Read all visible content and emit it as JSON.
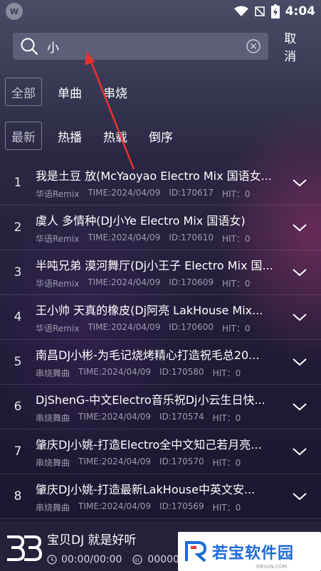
{
  "status_bar": {
    "time": "4:04",
    "icons": [
      "wifi-icon",
      "sim-off-icon",
      "battery-charging-icon"
    ]
  },
  "search": {
    "query": "小",
    "cancel_label": "取消"
  },
  "filters": {
    "type_row": [
      {
        "label": "全部",
        "active": true
      },
      {
        "label": "单曲",
        "active": false
      },
      {
        "label": "串烧",
        "active": false
      }
    ],
    "sort_row": [
      {
        "label": "最新",
        "active": true
      },
      {
        "label": "热播",
        "active": false
      },
      {
        "label": "热载",
        "active": false
      },
      {
        "label": "倒序",
        "active": false
      }
    ]
  },
  "songs": [
    {
      "num": "1",
      "title": "我是土豆 放(McYaoyao Electro Mix 国语女...",
      "genre": "华语Remix",
      "time": "TIME:2024/04/09",
      "id": "ID:170617",
      "hit": "HIT：0"
    },
    {
      "num": "2",
      "title": "虞人 多情种(DJ小Ye Electro Mix 国语女)",
      "genre": "华语Remix",
      "time": "TIME:2024/04/09",
      "id": "ID:170610",
      "hit": "HIT：0"
    },
    {
      "num": "3",
      "title": "半吨兄弟 漠河舞厅(Dj小王子 Electro Mix 国...",
      "genre": "华语Remix",
      "time": "TIME:2024/04/09",
      "id": "ID:170609",
      "hit": "HIT：0"
    },
    {
      "num": "4",
      "title": "王小帅 天真的橡皮(Dj阿亮 LakHouse Mix...",
      "genre": "华语Remix",
      "time": "TIME:2024/04/09",
      "id": "ID:170600",
      "hit": "HIT：0"
    },
    {
      "num": "5",
      "title": "南昌DJ小彬-为毛记烧烤精心打造祝毛总20...",
      "genre": "串烧舞曲",
      "time": "TIME:2024/04/09",
      "id": "ID:170580",
      "hit": "HIT：0"
    },
    {
      "num": "6",
      "title": "DjShenG-中文Electro音乐祝Dj小云生日快...",
      "genre": "串烧舞曲",
      "time": "TIME:2024/04/09",
      "id": "ID:170574",
      "hit": "HIT：0"
    },
    {
      "num": "7",
      "title": "肇庆DJ小姚-打造Electro全中文知己若月亮...",
      "genre": "串烧舞曲",
      "time": "TIME:2024/04/09",
      "id": "ID:170570",
      "hit": "HIT：0"
    },
    {
      "num": "8",
      "title": "肇庆DJ小姚-打造最新LakHouse中英文安...",
      "genre": "串烧舞曲",
      "time": "TIME:2024/04/09",
      "id": "ID:170569",
      "hit": "HIT：0"
    }
  ],
  "player": {
    "title": "宝贝DJ 就是好听",
    "progress": "00:00/00:00",
    "id": "000000"
  },
  "watermark": {
    "text": "若宝软件园",
    "sub": "RBSGN.COM"
  },
  "colors": {
    "accent_arrow": "#e8332c",
    "watermark_blue": "#1b6ad8"
  }
}
